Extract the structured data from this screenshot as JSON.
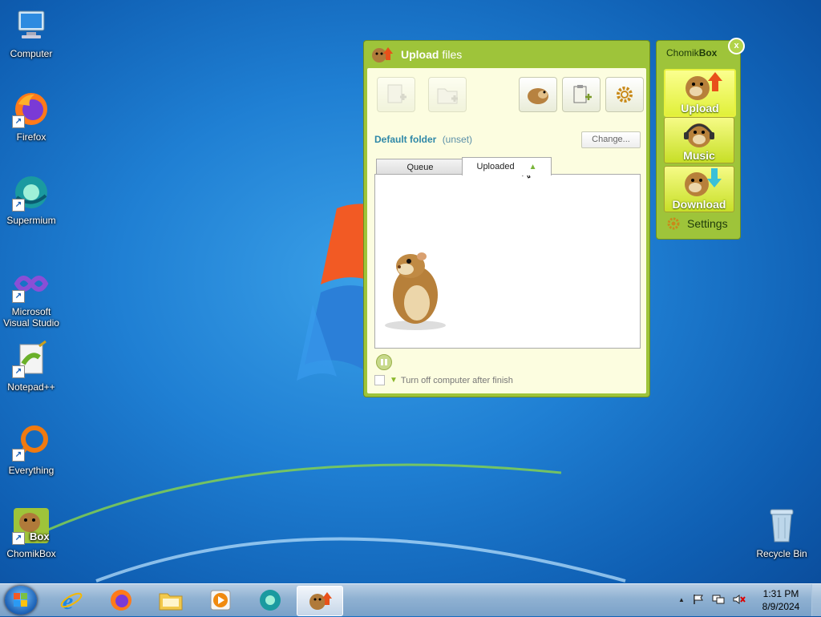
{
  "desktop": {
    "icons": [
      {
        "label": "Computer",
        "icon": "computer-icon"
      },
      {
        "label": "Firefox",
        "icon": "firefox-icon"
      },
      {
        "label": "Supermium",
        "icon": "supermium-icon"
      },
      {
        "label": "Microsoft Visual Studio",
        "icon": "visual-studio-icon"
      },
      {
        "label": "Notepad++",
        "icon": "notepadpp-icon"
      },
      {
        "label": "Everything",
        "icon": "everything-icon"
      },
      {
        "label": "ChomikBox",
        "icon": "chomikbox-icon"
      },
      {
        "label": "Recycle Bin",
        "icon": "recycle-bin-icon"
      }
    ],
    "vs_label_line1": "Microsoft",
    "vs_label_line2": "Visual Studio"
  },
  "upload_window": {
    "title_bold": "Upload",
    "title_rest": " files",
    "default_folder_label": "Default folder",
    "default_folder_value": "(unset)",
    "change_button": "Change...",
    "tabs": [
      {
        "label": "Queue",
        "active": false
      },
      {
        "label": "Uploaded",
        "active": true,
        "sort_indicator": "▲"
      }
    ],
    "shutdown_label": "Turn off computer after finish",
    "shutdown_checked": false
  },
  "side_panel": {
    "brand_regular": "Chomik",
    "brand_bold": "Box",
    "close_label": "x",
    "buttons": [
      {
        "label": "Upload",
        "active": true
      },
      {
        "label": "Music",
        "active": false
      },
      {
        "label": "Download",
        "active": false
      }
    ],
    "settings_label": "Settings"
  },
  "taskbar": {
    "clock_time": "1:31 PM",
    "clock_date": "8/9/2024",
    "tray_expand": "▲"
  },
  "colors": {
    "chomik_green": "#9ec43a",
    "panel_bg": "#fcfde0",
    "button_yellow": "#e1f03a",
    "desktop_blue": "#1f7fd3"
  }
}
